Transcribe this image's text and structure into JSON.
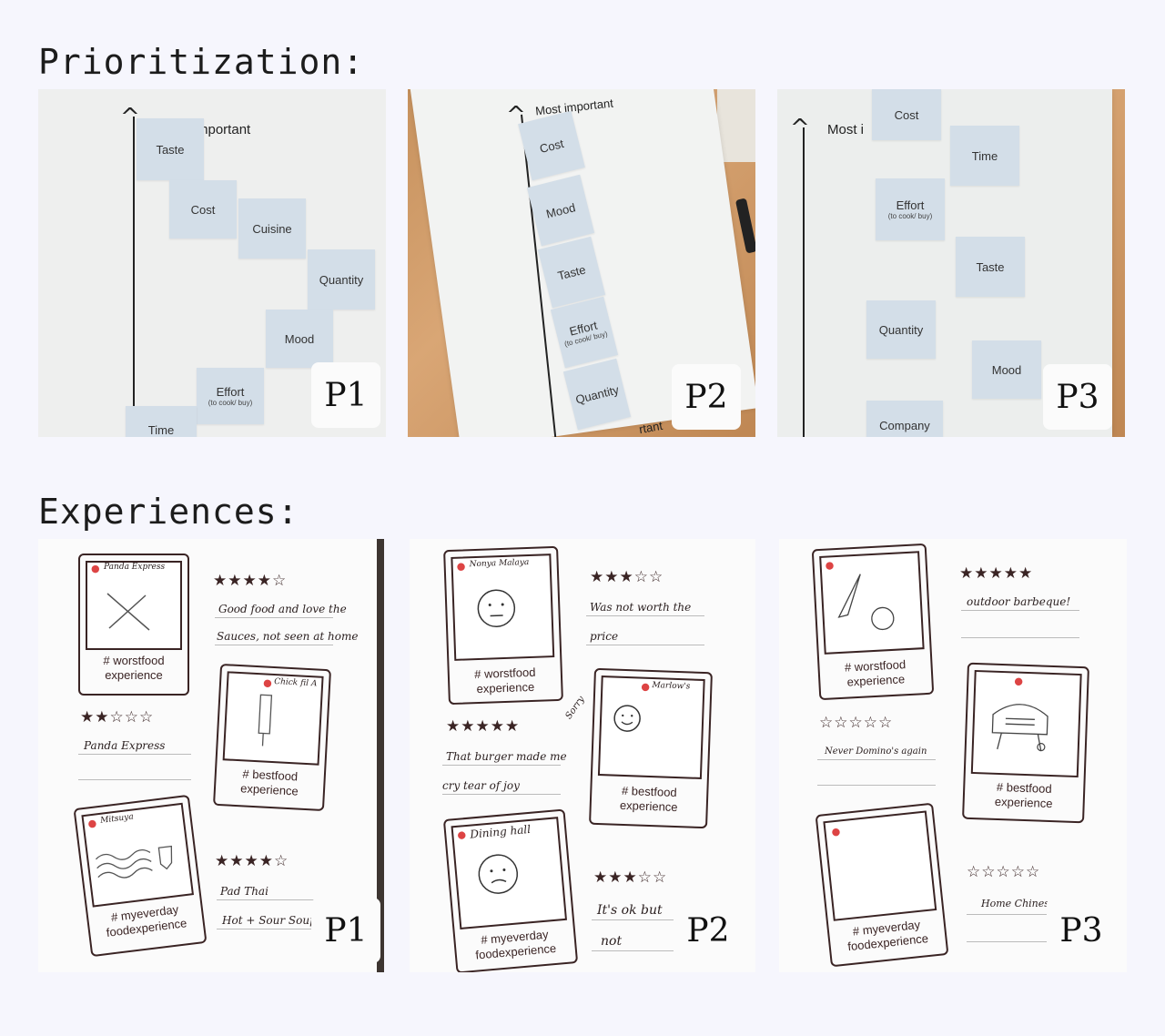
{
  "sections": {
    "prioritization_title": "Prioritization:",
    "experiences_title": "Experiences:"
  },
  "prioritization": {
    "p1": {
      "label": "P1",
      "axis": "Most important",
      "cards": [
        "Taste",
        "Cost",
        "Cuisine",
        "Quantity",
        "Mood",
        "Effort",
        "Time"
      ],
      "effort_sub": "(to cook/ buy)"
    },
    "p2": {
      "label": "P2",
      "axis": "Most important",
      "cards": [
        "Cost",
        "Mood",
        "Taste",
        "Effort",
        "Quantity"
      ],
      "effort_sub": "(to cook/ buy)",
      "bottom_fragment": "rtant"
    },
    "p3": {
      "label": "P3",
      "axis": "Most i",
      "cards": [
        "Cost",
        "Time",
        "Effort",
        "Taste",
        "Quantity",
        "Mood",
        "Company"
      ],
      "effort_sub": "(to cook/ buy)"
    }
  },
  "experiences": {
    "p1": {
      "label": "P1",
      "worst_caption": "# worstfood experience",
      "best_caption": "# bestfood experience",
      "everyday_caption": "# myeverday foodexperience",
      "worst_place": "Panda Express",
      "best_place": "Chick fil A",
      "everyday_place": "Mitsuya",
      "worst_stars": "★★☆☆☆",
      "best_stars": "★★★★☆",
      "everyday_stars": "★★★★☆",
      "worst_note": "Panda Express",
      "best_note_1": "Good food and love the",
      "best_note_2": "Sauces, not seen at home",
      "everyday_note_1": "Pad Thai",
      "everyday_note_2": "Hot + Sour Soup"
    },
    "p2": {
      "label": "P2",
      "worst_caption": "# worstfood experience",
      "best_caption": "# bestfood experience",
      "everyday_caption": "# myeverday foodexperience",
      "worst_place": "Nonya Malaya",
      "best_place": "Marlow's",
      "everyday_place": "Dining hall",
      "worst_stars": "★★★☆☆",
      "best_stars": "★★★★★",
      "everyday_stars": "★★★☆☆",
      "worst_note_1": "Was not worth the",
      "worst_note_2": "price",
      "sorry": "Sorry",
      "best_note_1": "That burger made me",
      "best_note_2": "cry tear of joy",
      "everyday_note_1": "It's ok but",
      "everyday_note_2": "not"
    },
    "p3": {
      "label": "P3",
      "worst_caption": "# worstfood experience",
      "best_caption": "# bestfood experience",
      "everyday_caption": "# myeverday foodexperience",
      "worst_stars": "☆☆☆☆☆",
      "best_stars": "★★★★★",
      "everyday_stars": "☆☆☆☆☆",
      "worst_note": "Never Domino's again",
      "best_note": "outdoor barbeque!",
      "everyday_note": "Home Chinese"
    }
  }
}
